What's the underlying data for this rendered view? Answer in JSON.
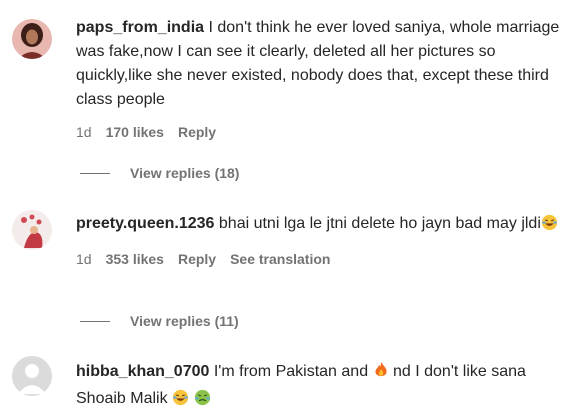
{
  "comments": [
    {
      "username": "paps_from_india",
      "text": "I don't think he ever loved saniya, whole marriage was fake,now I can see it clearly, deleted all her pictures so quickly,like she never existed, nobody does that, except these third class people",
      "age": "1d",
      "likes": "170 likes",
      "reply": "Reply",
      "view_replies": "View replies (18)"
    },
    {
      "username": "preety.queen.1236",
      "text": "bhai utni lga le jtni delete ho jayn bad may jldi",
      "emoji": "laughing-tears-emoji",
      "age": "1d",
      "likes": "353 likes",
      "reply": "Reply",
      "see_translation": "See translation",
      "view_replies": "View replies (11)"
    },
    {
      "username": "hibba_khan_0700",
      "text_part1": "I'm from Pakistan and",
      "emoji1": "fire-emoji",
      "text_part2": "nd I don't like sana Shoaib Malik",
      "emoji2": "laughing-tears-emoji",
      "emoji3": "nauseated-face-emoji"
    }
  ]
}
